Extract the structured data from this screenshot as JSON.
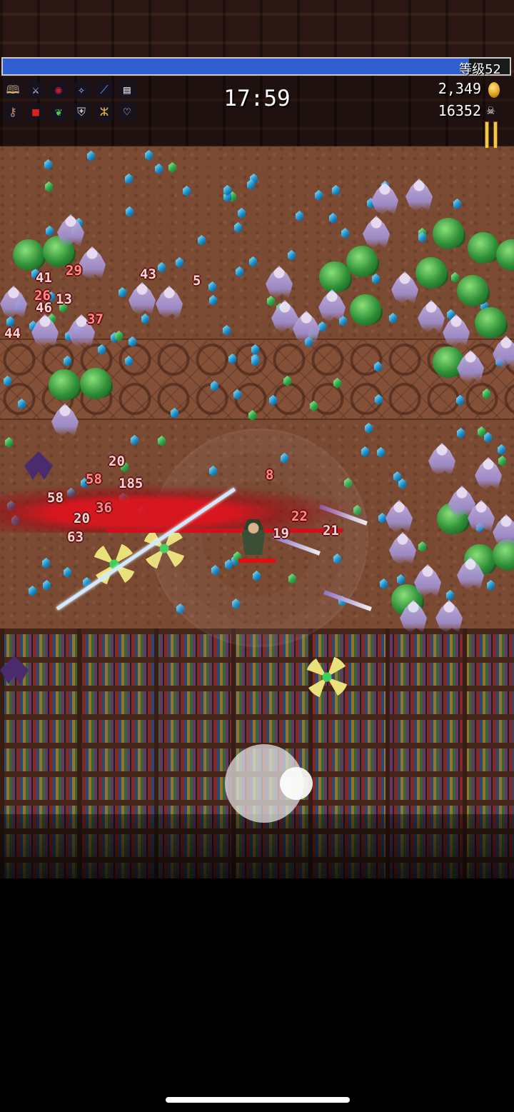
{
  "hud": {
    "level_label": "等级52",
    "xp_fraction": 0.92,
    "timer": "17:59",
    "gold": "2,349",
    "kills": "16352"
  },
  "weapons": [
    "bible-icon",
    "crossed-swords-icon",
    "red-circle-icon",
    "clock-lancet-icon",
    "magic-wand-icon",
    "book-icon"
  ],
  "passives": [
    "candelabra-icon",
    "tome-icon",
    "green-leaf-icon",
    "armor-icon",
    "candles-icon",
    "heart-icon"
  ],
  "damage_numbers": [
    "41",
    "29",
    "43",
    "5",
    "26",
    "13",
    "46",
    "37",
    "44",
    "20",
    "58",
    "185",
    "58",
    "36",
    "20",
    "63",
    "22",
    "19",
    "21",
    "8"
  ],
  "colors": {
    "xp_bar": "#2f5fd0",
    "floor": "#7a4a33",
    "hp_bar": "#e01010",
    "pause": "#f2c84b"
  }
}
